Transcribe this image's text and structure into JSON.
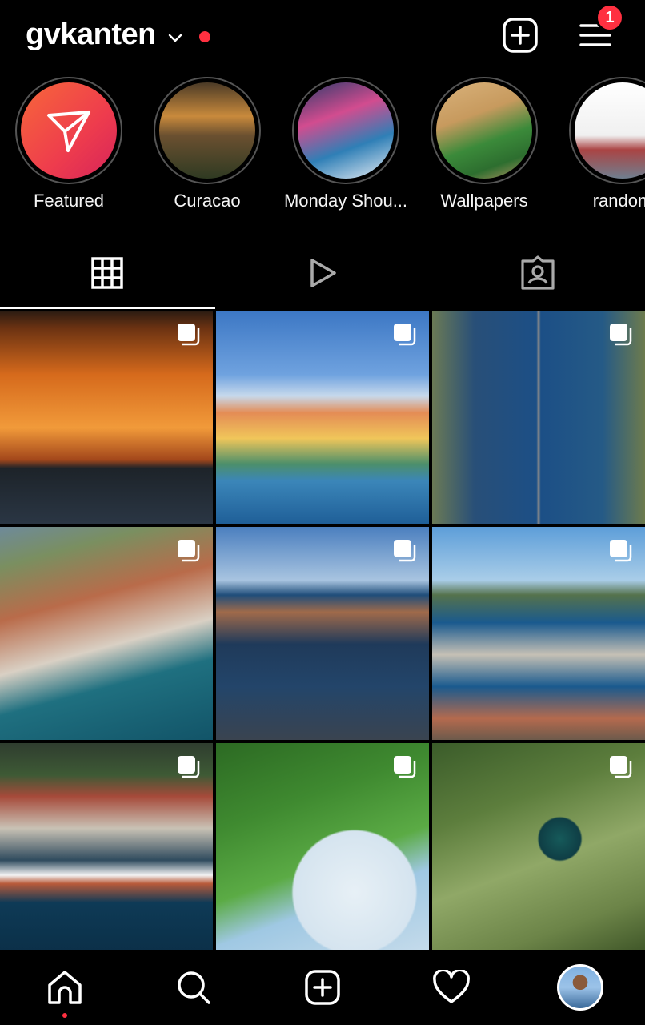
{
  "header": {
    "username": "gvkanten",
    "notification_count": "1"
  },
  "highlights": [
    {
      "label": "Featured"
    },
    {
      "label": "Curacao"
    },
    {
      "label": "Monday Shou..."
    },
    {
      "label": "Wallpapers"
    },
    {
      "label": "random"
    }
  ],
  "tabs": [
    {
      "icon": "grid-icon",
      "active": true
    },
    {
      "icon": "reels-icon",
      "active": false
    },
    {
      "icon": "tagged-icon",
      "active": false
    }
  ],
  "posts": [
    {
      "subject": "sunset over sea",
      "multiple": true
    },
    {
      "subject": "colorful waterfront houses",
      "multiple": true
    },
    {
      "subject": "aerial bridge over channel",
      "multiple": true
    },
    {
      "subject": "aerial harbor with cruise ship",
      "multiple": true
    },
    {
      "subject": "harbor channel and bridge",
      "multiple": true
    },
    {
      "subject": "pontoon bridge",
      "multiple": true
    },
    {
      "subject": "aerial cruise ship",
      "multiple": true
    },
    {
      "subject": "hummingbird among leaves",
      "multiple": true
    },
    {
      "subject": "hummingbird on branch",
      "multiple": true
    }
  ],
  "bottom_nav": [
    {
      "icon": "home-icon",
      "active": true
    },
    {
      "icon": "search-icon",
      "active": false
    },
    {
      "icon": "new-post-icon",
      "active": false
    },
    {
      "icon": "heart-icon",
      "active": false
    },
    {
      "icon": "profile-avatar",
      "active": false
    }
  ],
  "colors": {
    "background": "#000000",
    "accent": "#ff3040",
    "text": "#ffffff"
  }
}
